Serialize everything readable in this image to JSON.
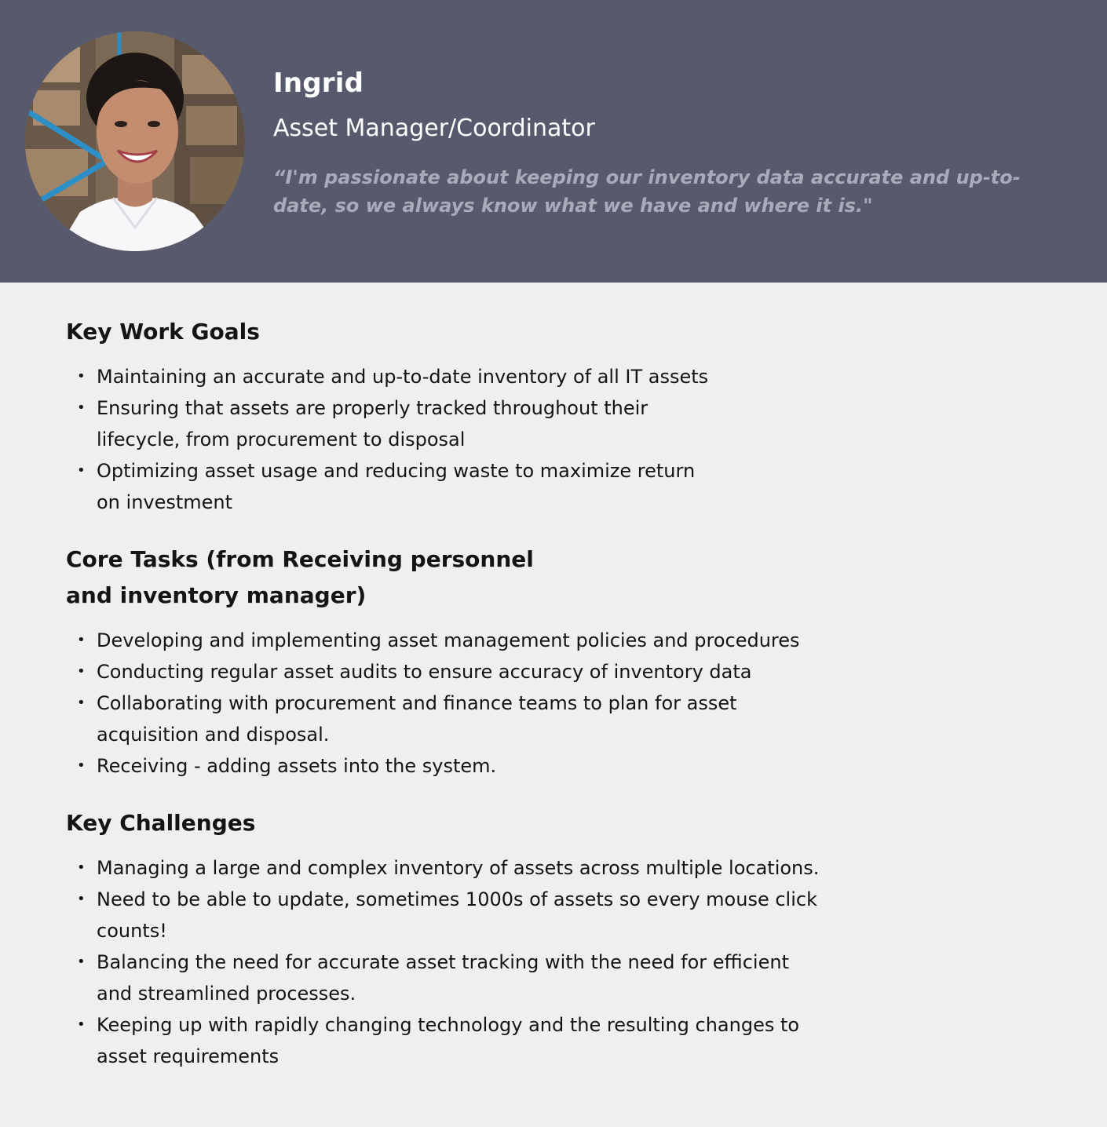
{
  "persona": {
    "name": "Ingrid",
    "role": "Asset Manager/Coordinator",
    "quote": "“I'm passionate about keeping our inventory data accurate and up-to-date, so we always know what we have and where it is.\"",
    "avatar_icon": "person-photo"
  },
  "sections": {
    "goals": {
      "title": "Key Work Goals",
      "items": [
        "Maintaining an accurate and up-to-date inventory of all IT assets",
        "Ensuring that assets are properly tracked throughout their lifecycle, from procurement to disposal",
        "Optimizing asset usage and reducing waste to maximize return on investment"
      ]
    },
    "tasks": {
      "title": "Core Tasks (from Receiving personnel and inventory manager)",
      "items": [
        "Developing and implementing asset management policies and procedures",
        "Conducting regular asset audits to ensure accuracy of inventory data",
        "Collaborating with procurement and finance teams to plan for asset acquisition and disposal.",
        "Receiving - adding assets into the system."
      ]
    },
    "challenges": {
      "title": "Key Challenges",
      "items": [
        "Managing a large and complex inventory of assets across multiple locations.",
        "Need to be able to update, sometimes 1000s of assets so every mouse click counts!",
        "Balancing the need for accurate asset tracking with the need for efficient and streamlined processes.",
        "Keeping up with rapidly changing technology and the resulting changes to asset requirements"
      ]
    }
  },
  "colors": {
    "header_bg": "#575a6d",
    "page_bg": "#efefef",
    "quote_text": "#a8acba"
  }
}
